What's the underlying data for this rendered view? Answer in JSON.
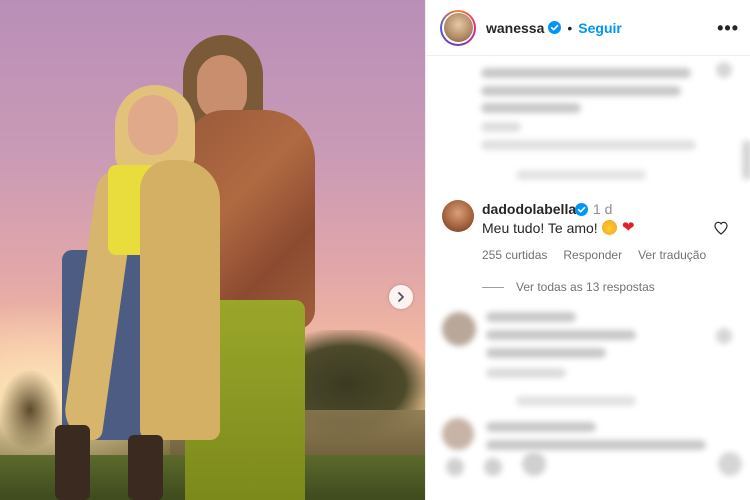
{
  "post": {
    "username": "wanessa",
    "separator": "•",
    "follow_label": "Seguir",
    "more_label": "•••"
  },
  "comment": {
    "username": "dadodolabella",
    "time": "1 d",
    "text": "Meu tudo! Te amo!",
    "emoji_heart": "❤",
    "likes": "255 curtidas",
    "reply_label": "Responder",
    "translate_label": "Ver tradução",
    "view_replies": "Ver todas as 13 respostas"
  },
  "colors": {
    "follow": "#0095f6",
    "verified": "#0095f6"
  },
  "icons": {
    "verified": "verified-badge-icon",
    "heart": "heart-outline-icon",
    "next": "chevron-right-icon",
    "more": "more-options-icon"
  }
}
